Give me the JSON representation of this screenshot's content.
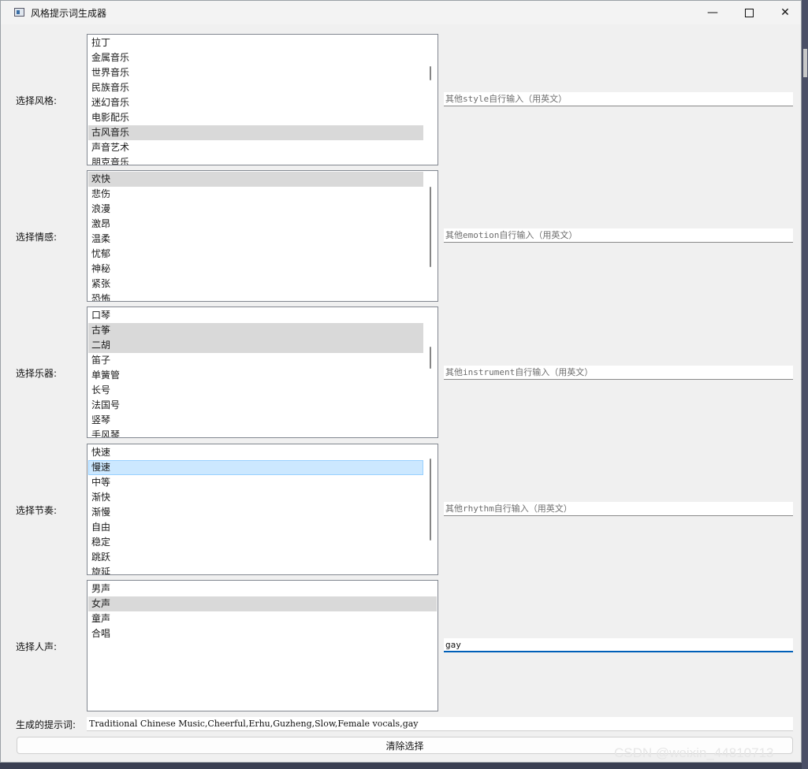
{
  "window": {
    "title": "风格提示词生成器",
    "minimize": "—",
    "close": "✕"
  },
  "rows": [
    {
      "label": "选择风格:",
      "items": [
        {
          "text": "拉丁",
          "state": ""
        },
        {
          "text": "金属音乐",
          "state": ""
        },
        {
          "text": "世界音乐",
          "state": ""
        },
        {
          "text": "民族音乐",
          "state": ""
        },
        {
          "text": "迷幻音乐",
          "state": ""
        },
        {
          "text": "电影配乐",
          "state": ""
        },
        {
          "text": "古风音乐",
          "state": "selected"
        },
        {
          "text": "声音艺术",
          "state": ""
        },
        {
          "text": "朋克音乐",
          "state": ""
        }
      ],
      "placeholder": "其他style自行输入（用英文）",
      "value": ""
    },
    {
      "label": "选择情感:",
      "items": [
        {
          "text": "欢快",
          "state": "selected"
        },
        {
          "text": "悲伤",
          "state": ""
        },
        {
          "text": "浪漫",
          "state": ""
        },
        {
          "text": "激昂",
          "state": ""
        },
        {
          "text": "温柔",
          "state": ""
        },
        {
          "text": "忧郁",
          "state": ""
        },
        {
          "text": "神秘",
          "state": ""
        },
        {
          "text": "紧张",
          "state": ""
        },
        {
          "text": "恐怖",
          "state": ""
        }
      ],
      "placeholder": "其他emotion自行输入（用英文）",
      "value": ""
    },
    {
      "label": "选择乐器:",
      "items": [
        {
          "text": "口琴",
          "state": ""
        },
        {
          "text": "古筝",
          "state": "selected"
        },
        {
          "text": "二胡",
          "state": "selected"
        },
        {
          "text": "笛子",
          "state": ""
        },
        {
          "text": "单簧管",
          "state": ""
        },
        {
          "text": "长号",
          "state": ""
        },
        {
          "text": "法国号",
          "state": ""
        },
        {
          "text": "竖琴",
          "state": ""
        },
        {
          "text": "手风琴",
          "state": ""
        }
      ],
      "placeholder": "其他instrument自行输入（用英文）",
      "value": ""
    },
    {
      "label": "选择节奏:",
      "items": [
        {
          "text": "快速",
          "state": ""
        },
        {
          "text": "慢速",
          "state": "current"
        },
        {
          "text": "中等",
          "state": ""
        },
        {
          "text": "渐快",
          "state": ""
        },
        {
          "text": "渐慢",
          "state": ""
        },
        {
          "text": "自由",
          "state": ""
        },
        {
          "text": "稳定",
          "state": ""
        },
        {
          "text": "跳跃",
          "state": ""
        },
        {
          "text": "旋延",
          "state": ""
        }
      ],
      "placeholder": "其他rhythm自行输入（用英文）",
      "value": ""
    },
    {
      "label": "选择人声:",
      "items": [
        {
          "text": "男声",
          "state": ""
        },
        {
          "text": "女声",
          "state": "selected"
        },
        {
          "text": "童声",
          "state": ""
        },
        {
          "text": "合唱",
          "state": ""
        }
      ],
      "placeholder": "",
      "value": "gay"
    }
  ],
  "output": {
    "label": "生成的提示词:",
    "value": "Traditional Chinese Music,Cheerful,Erhu,Guzheng,Slow,Female vocals,gay"
  },
  "clear_button": "清除选择",
  "watermark": "CSDN @weixin_44810713"
}
